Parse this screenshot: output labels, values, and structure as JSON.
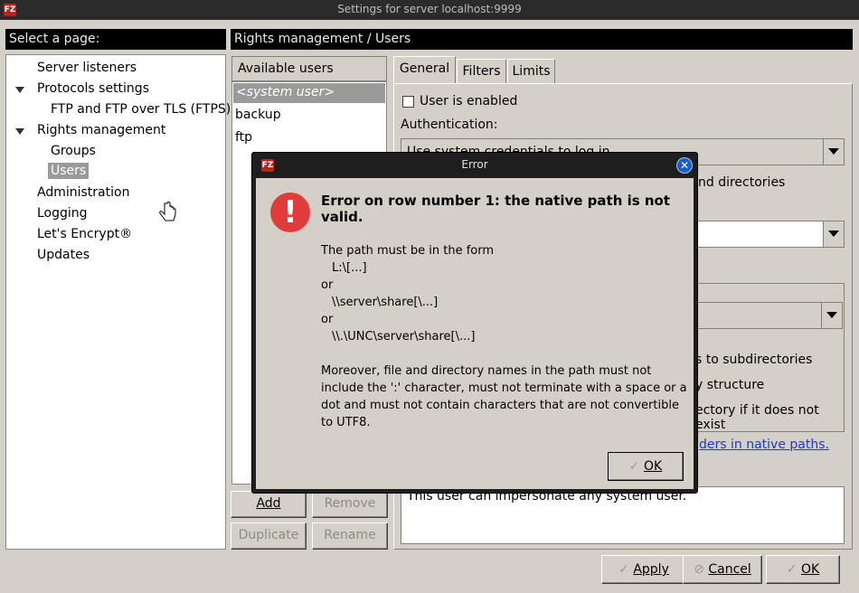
{
  "window": {
    "title": "Settings for server localhost:9999",
    "logo": "FZ"
  },
  "left_panel": {
    "header": "Select a page:",
    "tree": [
      {
        "label": "Server listeners"
      },
      {
        "label": "Protocols settings"
      },
      {
        "label": "FTP and FTP over TLS (FTPS)"
      },
      {
        "label": "Rights management"
      },
      {
        "label": "Groups"
      },
      {
        "label": "Users"
      },
      {
        "label": "Administration"
      },
      {
        "label": "Logging"
      },
      {
        "label": "Let's Encrypt®"
      },
      {
        "label": "Updates"
      }
    ]
  },
  "right_panel": {
    "header": "Rights management / Users",
    "users_list": {
      "header": "Available users",
      "items": [
        "<system user>",
        "backup",
        "ftp"
      ]
    },
    "buttons": {
      "add": "Add",
      "remove": "Remove",
      "duplicate": "Duplicate",
      "rename": "Rename"
    },
    "tabs": [
      "General",
      "Filters",
      "Limits"
    ],
    "general": {
      "user_enabled_label": "User is enabled",
      "authentication_label": "Authentication:",
      "authentication_value": "Use system credentials to log in",
      "partial_directories": "nd directories",
      "partial_subdirectories": "s to subdirectories",
      "partial_structure": "y structure",
      "partial_create": "ectory if it does not exist",
      "partial_link": "ders in native paths.",
      "description_text": "This user can impersonate any system user."
    }
  },
  "footer": {
    "apply": "Apply",
    "cancel": "Cancel",
    "ok": "OK"
  },
  "dialog": {
    "title": "Error",
    "heading": "Error on row number 1: the native path is not valid.",
    "body_lines": [
      "The path must be in the form",
      "L:\\[...]",
      "or",
      "\\\\server\\share[\\...]",
      "or",
      "\\\\.\\UNC\\server\\share[\\...]"
    ],
    "body_paragraph": "Moreover, file and directory names in the path must not include the ':' character, must not terminate with a space or a dot and must not contain characters that are not convertible to UTF8.",
    "ok": "OK",
    "close_glyph": "✕",
    "error_glyph": "!"
  }
}
